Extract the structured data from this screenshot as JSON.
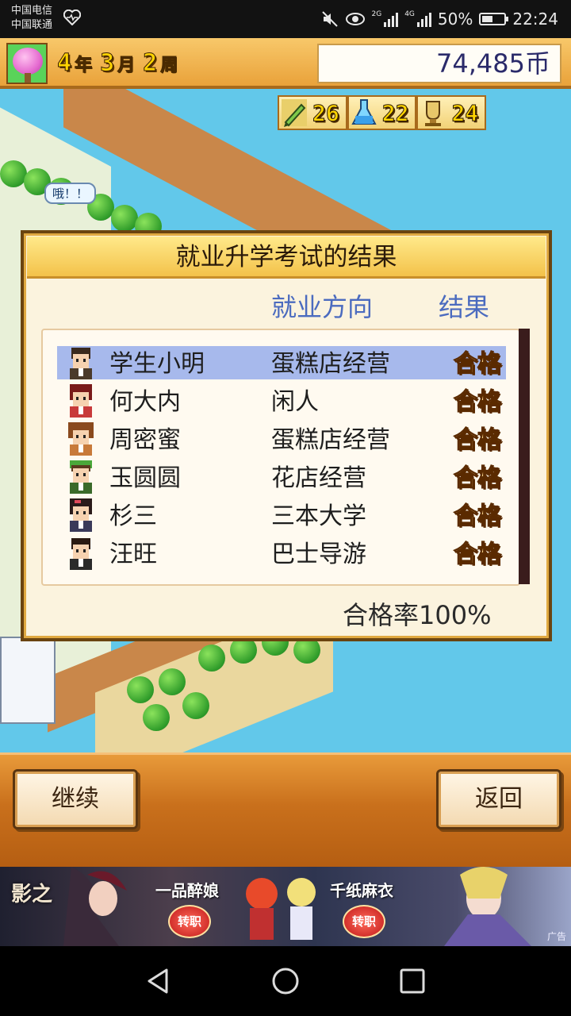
{
  "status_bar": {
    "carrier1": "中国电信",
    "carrier2": "中国联通",
    "net1": "2G",
    "net2": "4G",
    "battery": "50%",
    "battery_level": 0.5,
    "time": "22:24"
  },
  "header": {
    "year": "4",
    "year_unit": "年",
    "month": "3",
    "month_unit": "月",
    "week": "2",
    "week_unit": "周",
    "money": "74,485币"
  },
  "stats": [
    {
      "icon": "pencil-icon",
      "value": "26"
    },
    {
      "icon": "flask-icon",
      "value": "22"
    },
    {
      "icon": "trophy-icon",
      "value": "24"
    }
  ],
  "map": {
    "speech_bubble": "哦！！"
  },
  "dialog": {
    "title": "就业升学考试的结果",
    "col_career": "就业方向",
    "col_result": "结果",
    "rows": [
      {
        "name": "学生小明",
        "career": "蛋糕店经营",
        "result": "合格",
        "selected": true
      },
      {
        "name": "何大内",
        "career": "闲人",
        "result": "合格"
      },
      {
        "name": "周密蜜",
        "career": "蛋糕店经营",
        "result": "合格"
      },
      {
        "name": "玉圆圆",
        "career": "花店经营",
        "result": "合格"
      },
      {
        "name": "杉三",
        "career": "三本大学",
        "result": "合格"
      },
      {
        "name": "汪旺",
        "career": "巴士导游",
        "result": "合格"
      }
    ],
    "pass_rate": "合格率100%"
  },
  "buttons": {
    "continue": "继续",
    "back": "返回"
  },
  "ad": {
    "logo": "影之",
    "text1": "一品醉娘",
    "text2": "千纸麻衣",
    "btn1": "转职",
    "btn2": "转职",
    "mark": "广告"
  },
  "colors": {
    "accent": "#4b6bbf",
    "selected_row": "#a7b9ec",
    "header_bg": "#f8c86a",
    "sea": "#62c8ea"
  }
}
